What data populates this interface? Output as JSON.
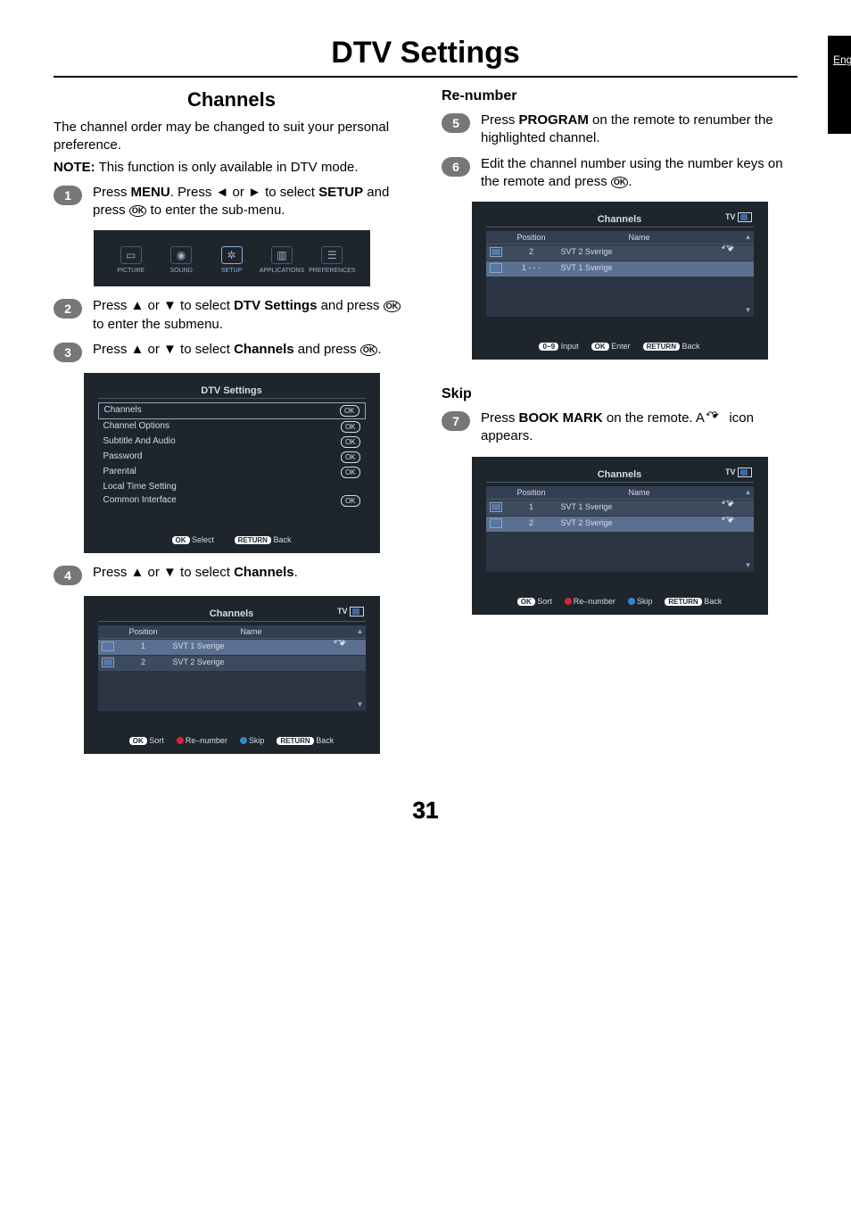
{
  "sideTab": "English",
  "title": "DTV Settings",
  "pageNumber": "31",
  "left": {
    "sectionTitle": "Channels",
    "intro": "The channel order may be changed to suit your personal preference.",
    "noteLabel": "NOTE:",
    "noteText": "This function is only available in DTV mode.",
    "steps": [
      {
        "n": "1",
        "pre": "Press ",
        "b1": "MENU",
        "mid": ". Press ◄ or ► to select ",
        "b2": "SETUP",
        "post": " and press ",
        "ok": "OK",
        "post2": " to enter the sub-menu."
      },
      {
        "n": "2",
        "pre": "Press ▲ or ▼ to select ",
        "b1": "DTV Settings",
        "mid": " and press ",
        "ok": "OK",
        "post": " to enter the submenu."
      },
      {
        "n": "3",
        "pre": "Press ▲ or ▼ to select ",
        "b1": "Channels",
        "mid": " and press ",
        "ok": "OK",
        "post": "."
      },
      {
        "n": "4",
        "pre": "Press ▲ or ▼ to select ",
        "b1": "Channels",
        "post": "."
      }
    ],
    "menuStrip": {
      "items": [
        {
          "label": "PICTURE",
          "glyph": "▭"
        },
        {
          "label": "SOUND",
          "glyph": "◉"
        },
        {
          "label": "SETUP",
          "glyph": "✲",
          "active": true
        },
        {
          "label": "APPLICATIONS",
          "glyph": "▥"
        },
        {
          "label": "PREFERENCES",
          "glyph": "☰"
        }
      ]
    },
    "dtvPanel": {
      "title": "DTV Settings",
      "rows": [
        {
          "label": "Channels",
          "value": "OK",
          "selected": true
        },
        {
          "label": "Channel Options",
          "value": "OK"
        },
        {
          "label": "Subtitle And Audio",
          "value": "OK"
        },
        {
          "label": "Password",
          "value": "OK"
        },
        {
          "label": "Parental",
          "value": "OK"
        },
        {
          "label": "Local Time Setting",
          "value": ""
        },
        {
          "label": "Common Interface",
          "value": "OK"
        }
      ],
      "footerOk": "OK",
      "footerOkLabel": "Select",
      "footerReturn": "RETURN",
      "footerReturnLabel": "Back"
    },
    "channelsPanel": {
      "title": "Channels",
      "tv": "TV",
      "headers": {
        "pos": "Position",
        "name": "Name"
      },
      "rows": [
        {
          "pos": "1",
          "name": "SVT 1 Sverige",
          "selected": true,
          "skip": true
        },
        {
          "pos": "2",
          "name": "SVT 2 Sverige"
        }
      ],
      "legend": {
        "okKey": "OK",
        "okLabel": "Sort",
        "redLabel": "Re–number",
        "blueLabel": "Skip",
        "retKey": "RETURN",
        "retLabel": "Back"
      }
    }
  },
  "right": {
    "heading1": "Re-number",
    "steps1": [
      {
        "n": "5",
        "pre": "Press ",
        "b1": "PROGRAM",
        "post": " on the remote to renumber the highlighted channel."
      },
      {
        "n": "6",
        "pre": "Edit the channel number using the number keys on the remote and press ",
        "ok": "OK",
        "post": "."
      }
    ],
    "renumberPanel": {
      "title": "Channels",
      "tv": "TV",
      "headers": {
        "pos": "Position",
        "name": "Name"
      },
      "rows": [
        {
          "pos": "2",
          "name": "SVT 2 Sverige",
          "skip": true
        },
        {
          "pos": "1  -  -  -",
          "name": "SVT 1 Sverige",
          "selected": true
        }
      ],
      "legend": {
        "numKey": "0~9",
        "numLabel": "Input",
        "okKey": "OK",
        "okLabel": "Enter",
        "retKey": "RETURN",
        "retLabel": "Back"
      }
    },
    "heading2": "Skip",
    "steps2": [
      {
        "n": "7",
        "pre": "Press ",
        "b1": "BOOK MARK",
        "mid": " on the remote. A ",
        "post": " icon appears."
      }
    ],
    "skipPanel": {
      "title": "Channels",
      "tv": "TV",
      "headers": {
        "pos": "Position",
        "name": "Name"
      },
      "rows": [
        {
          "pos": "1",
          "name": "SVT 1 Sverige",
          "skip": true
        },
        {
          "pos": "2",
          "name": "SVT 2 Sverige",
          "selected": true,
          "skip": true
        }
      ],
      "legend": {
        "okKey": "OK",
        "okLabel": "Sort",
        "redLabel": "Re–number",
        "blueLabel": "Skip",
        "retKey": "RETURN",
        "retLabel": "Back"
      }
    }
  }
}
